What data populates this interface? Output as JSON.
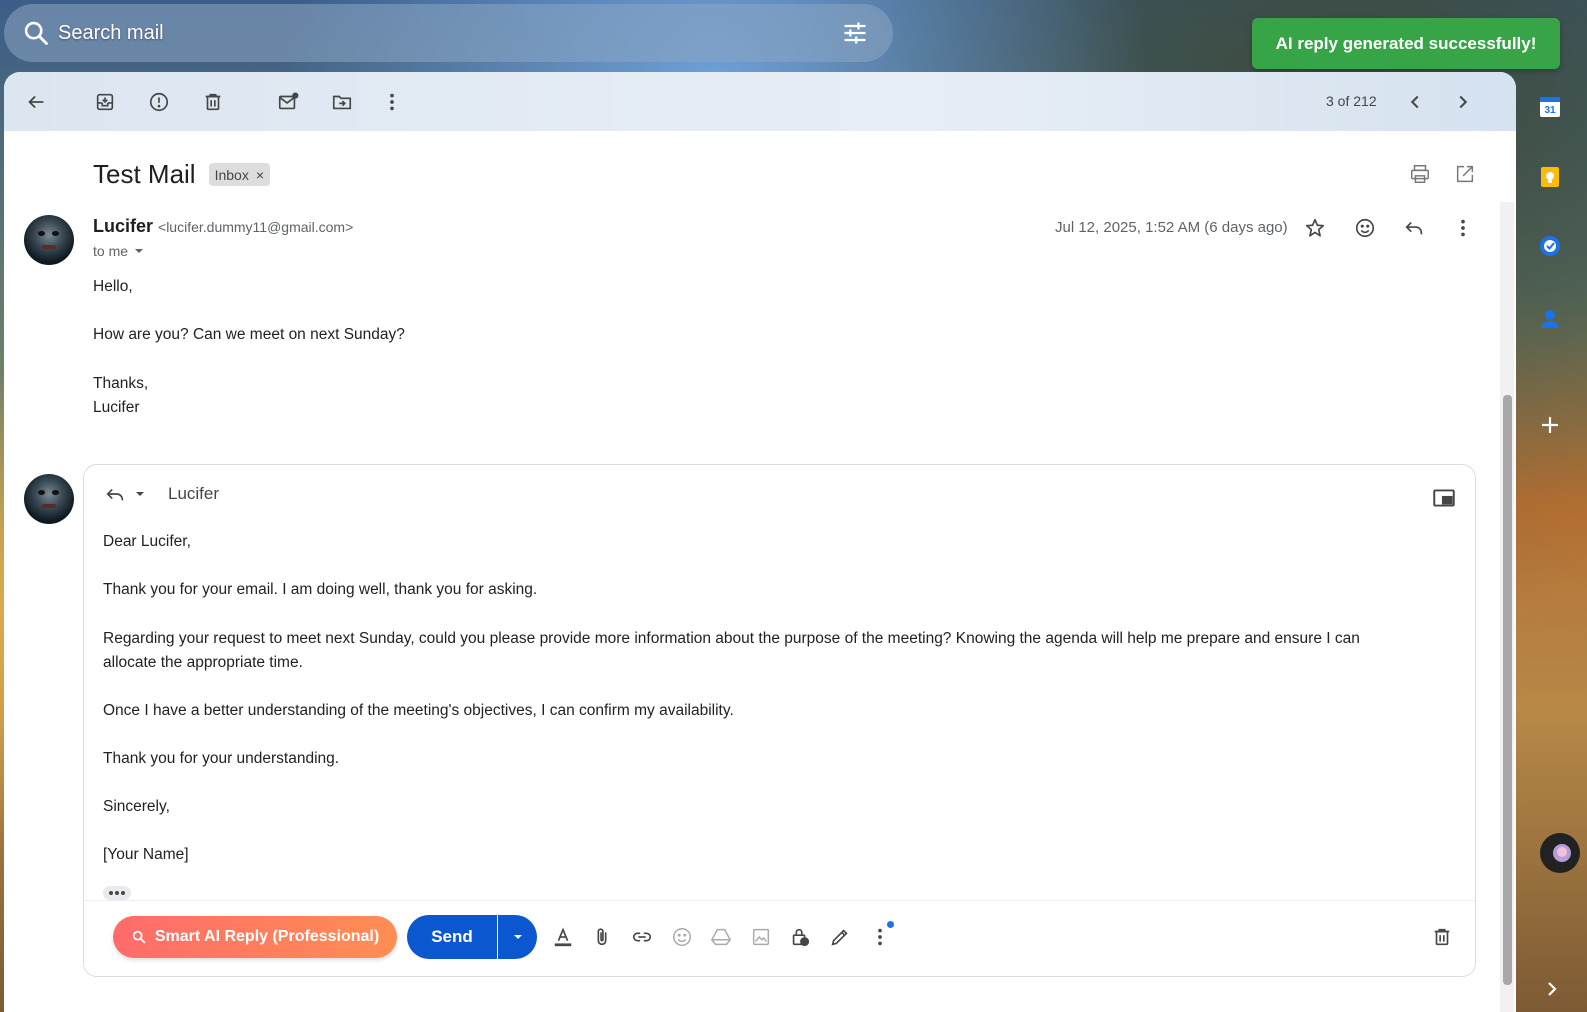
{
  "search": {
    "placeholder": "Search mail"
  },
  "toast": {
    "text": "AI reply generated successfully!"
  },
  "toolbar": {
    "pager": "3 of 212"
  },
  "message": {
    "subject": "Test Mail",
    "label": "Inbox",
    "label_close": "×",
    "sender_name": "Lucifer",
    "sender_email": "<lucifer.dummy11@gmail.com>",
    "to": "to me",
    "date": "Jul 12, 2025, 1:52 AM (6 days ago)",
    "body": [
      "Hello,",
      "How are you? Can we meet on next Sunday?",
      "Thanks,",
      "Lucifer"
    ]
  },
  "reply": {
    "recipient": "Lucifer",
    "lines": [
      "Dear Lucifer,",
      "Thank you for your email. I am doing well, thank you for asking.",
      "Regarding your request to meet next Sunday, could you please provide more information about the purpose of the meeting? Knowing the agenda will help me prepare and ensure I can",
      "allocate the appropriate time.",
      "Once I have a better understanding of the meeting's objectives, I can confirm my availability.",
      "Thank you for your understanding.",
      "Sincerely,",
      "[Your Name]"
    ],
    "smart_ai_label": "Smart AI Reply (Professional)",
    "send_label": "Send"
  },
  "rail": {
    "calendar_day": "31"
  },
  "colors": {
    "send": "#0b57d0",
    "toast": "#37a547",
    "smart_ai_start": "#ff6b6b",
    "smart_ai_end": "#ff8e53"
  }
}
